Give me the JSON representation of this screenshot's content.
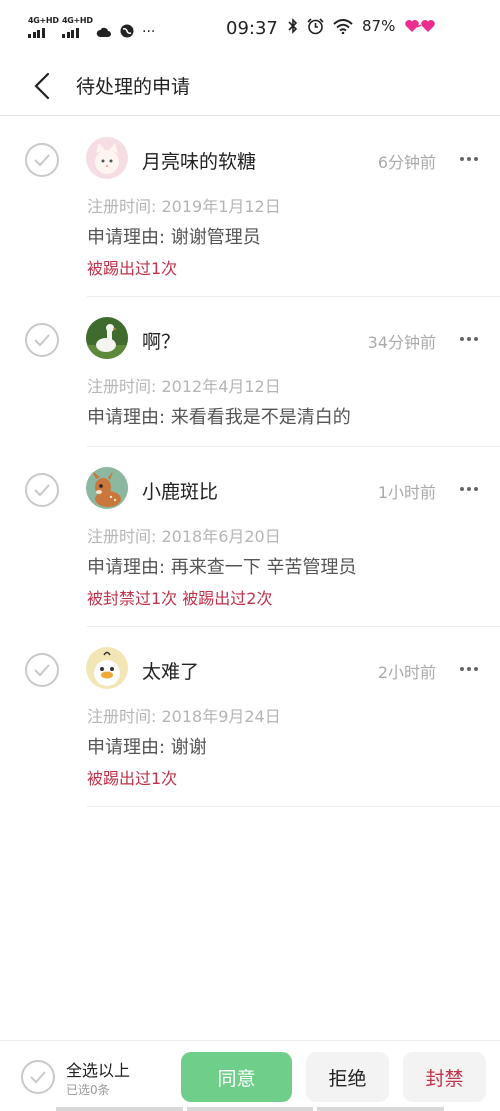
{
  "status_bar": {
    "net1": "4G+HD",
    "net2": "4G+HD",
    "more": "···",
    "time": "09:37",
    "battery": "87%"
  },
  "header": {
    "title": "待处理的申请"
  },
  "requests": [
    {
      "name": "月亮味的软糖",
      "time": "6分钟前",
      "registered": "注册时间: 2019年1月12日",
      "reason": "申请理由: 谢谢管理员",
      "warning": "被踢出过1次",
      "avatar": "pink-cat-avatar"
    },
    {
      "name": "啊？",
      "time": "34分钟前",
      "registered": "注册时间: 2012年4月12日",
      "reason": "申请理由: 来看看我是不是清白的",
      "warning": "",
      "avatar": "goose-avatar"
    },
    {
      "name": "小鹿斑比",
      "time": "1小时前",
      "registered": "注册时间: 2018年6月20日",
      "reason": "申请理由: 再来查一下 辛苦管理员",
      "warning": "被封禁过1次 被踢出过2次",
      "avatar": "bambi-avatar"
    },
    {
      "name": "太难了",
      "time": "2小时前",
      "registered": "注册时间: 2018年9月24日",
      "reason": "申请理由: 谢谢",
      "warning": "被踢出过1次",
      "avatar": "duck-avatar"
    }
  ],
  "bottom_bar": {
    "select_all": "全选以上",
    "selected_count": "已选0条",
    "agree": "同意",
    "reject": "拒绝",
    "ban": "封禁"
  },
  "colors": {
    "accent_green": "#6fce8a",
    "warning_red": "#c0334a"
  }
}
